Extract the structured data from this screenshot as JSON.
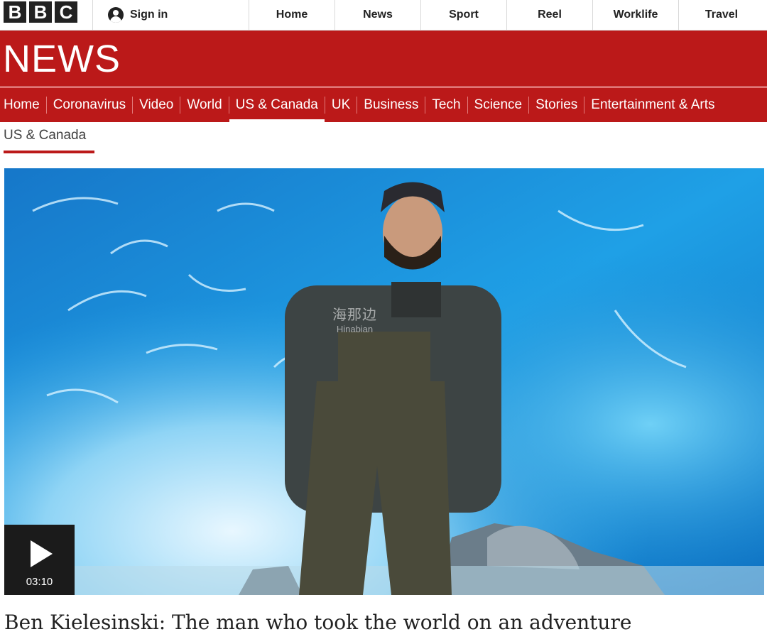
{
  "global_nav": {
    "logo_letters": [
      "B",
      "B",
      "C"
    ],
    "sign_in_label": "Sign in",
    "items": [
      "Home",
      "News",
      "Sport",
      "Reel",
      "Worklife",
      "Travel"
    ]
  },
  "news": {
    "title": "NEWS",
    "brand_color": "#bb1919"
  },
  "section_nav": {
    "items": [
      "Home",
      "Coronavirus",
      "Video",
      "World",
      "US & Canada",
      "UK",
      "Business",
      "Tech",
      "Science",
      "Stories",
      "Entertainment & Arts"
    ],
    "active": "US & Canada"
  },
  "sub_nav": {
    "label": "US & Canada"
  },
  "hero": {
    "duration": "03:10",
    "watermark_cn": "海那边",
    "watermark_en": "Hinabian"
  },
  "article": {
    "headline": "Ben Kielesinski: The man who took the world on an adventure"
  }
}
